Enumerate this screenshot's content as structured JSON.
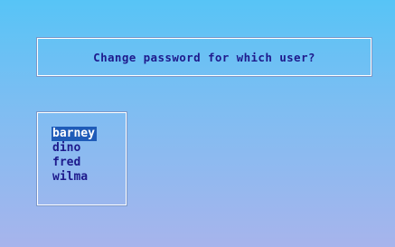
{
  "dialog": {
    "prompt": "Change password for which user?"
  },
  "user_list": {
    "selected_index": 0,
    "items": [
      "barney",
      "dino",
      "fred",
      "wilma"
    ]
  },
  "colors": {
    "text": "#1e1a8c",
    "selection_background": "#1f5bb8",
    "selection_text": "#ffffff",
    "background_top": "#57c4f6",
    "background_bottom": "#a7b4ec"
  }
}
